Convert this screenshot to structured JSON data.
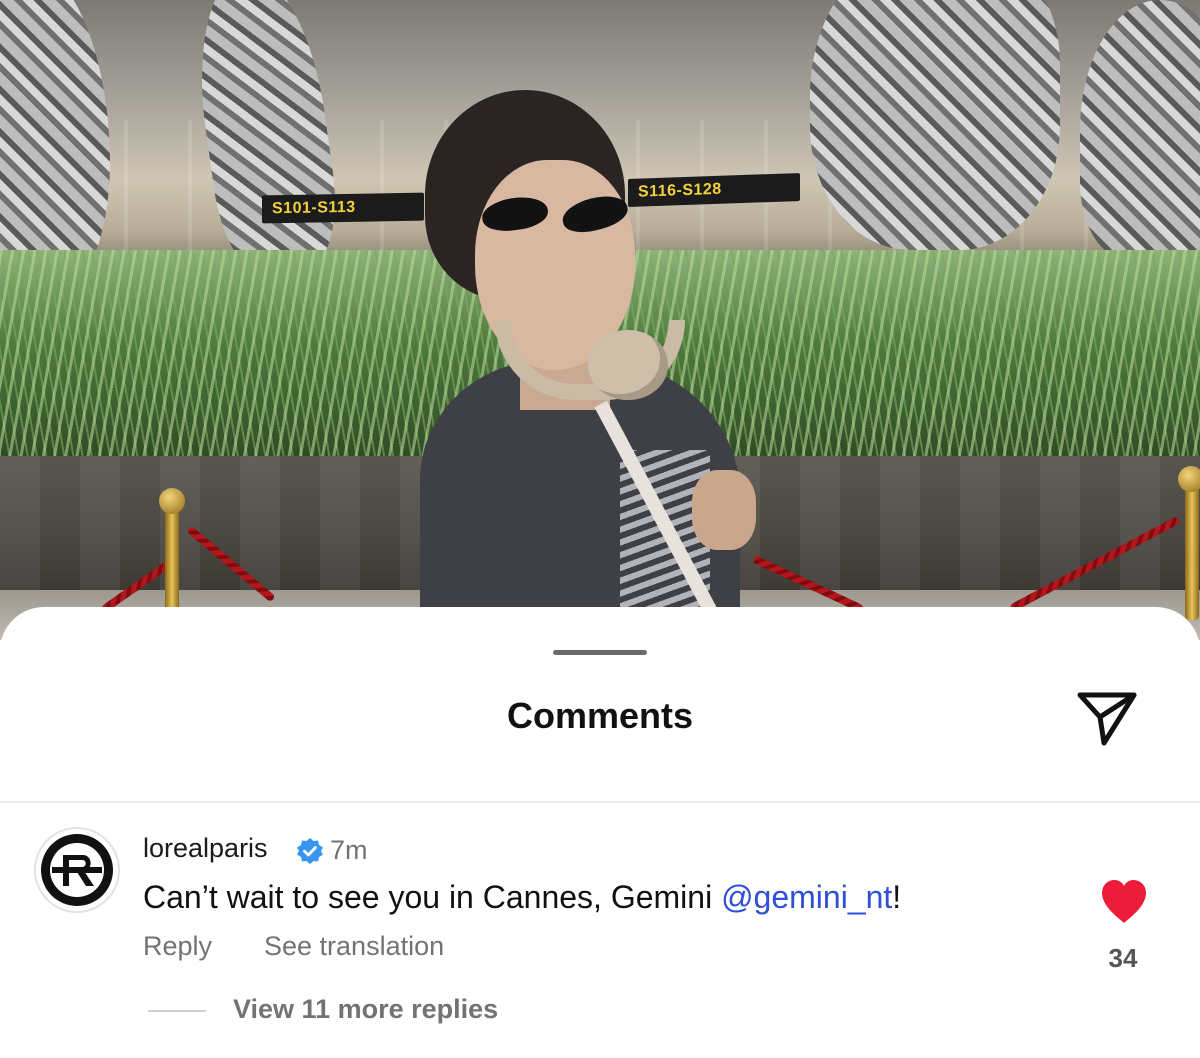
{
  "photo": {
    "sign_left": "S101-S113",
    "sign_right": "S116-S128"
  },
  "sheet": {
    "title": "Comments",
    "share_icon": "paper-plane-icon"
  },
  "comment": {
    "avatar_icon": "loreal-paris-logo",
    "username": "lorealparis",
    "verified_icon": "verified-badge-icon",
    "time": "7m",
    "text_before": "Can’t wait to see you in Cannes, Gemini ",
    "mention": "@gemini_nt",
    "text_after": "!",
    "reply_label": "Reply",
    "translation_label": "See translation",
    "like_icon": "heart-filled-icon",
    "like_count": "34",
    "view_replies_label": "View 11 more replies"
  },
  "colors": {
    "accent_link": "#2f4fd6",
    "heart": "#ed1c3a",
    "verified": "#3797f0",
    "muted_text": "#737373"
  }
}
